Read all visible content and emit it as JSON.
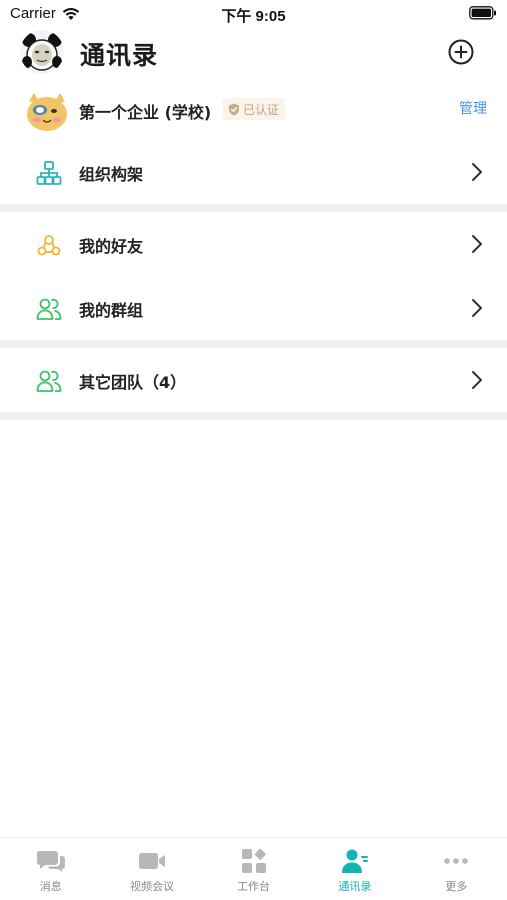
{
  "status_bar": {
    "carrier": "Carrier",
    "time": "下午 9:05"
  },
  "header": {
    "title": "通讯录"
  },
  "company": {
    "name": "第一个企业 (学校)",
    "badge": "已认证",
    "manage_label": "管理"
  },
  "rows": [
    {
      "label": "组织构架",
      "icon": "org-chart-icon"
    },
    {
      "label": "我的好友",
      "icon": "friends-icon"
    },
    {
      "label": "我的群组",
      "icon": "group-icon"
    },
    {
      "label": "其它团队（4）",
      "icon": "team-icon"
    }
  ],
  "tab_bar": {
    "active": "contacts",
    "tabs": [
      {
        "label": "消息",
        "icon": "chat-bubbles-icon"
      },
      {
        "label": "视频会议",
        "icon": "video-camera-icon"
      },
      {
        "label": "工作台",
        "icon": "workbench-icon"
      },
      {
        "label": "通讯录",
        "icon": "contacts-icon"
      },
      {
        "label": "更多",
        "icon": "more-dots-icon"
      }
    ]
  },
  "colors": {
    "accent": "#13b5b1",
    "link": "#4a90e2",
    "org_icon": "#2bb3c0",
    "friends_icon": "#f3b52a",
    "green_icon": "#3cc36a",
    "tab_inactive": "#b8b8b8"
  }
}
